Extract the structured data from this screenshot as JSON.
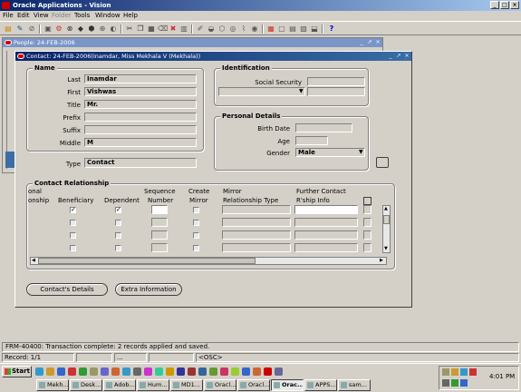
{
  "app": {
    "title": "Oracle Applications - Vision"
  },
  "menu": [
    {
      "label": "File",
      "enabled": true
    },
    {
      "label": "Edit",
      "enabled": true
    },
    {
      "label": "View",
      "enabled": true
    },
    {
      "label": "Folder",
      "enabled": false
    },
    {
      "label": "Tools",
      "enabled": true
    },
    {
      "label": "Window",
      "enabled": true
    },
    {
      "label": "Help",
      "enabled": true
    }
  ],
  "people_window": {
    "title": "People: 24-FEB-2006"
  },
  "contact_window": {
    "title": "Contact: 24-FEB-2006(Inamdar, Miss Mekhala V (Mekhala))",
    "name": {
      "group_label": "Name",
      "last_label": "Last",
      "last_value": "Inamdar",
      "first_label": "First",
      "first_value": "Vishwas",
      "title_label": "Title",
      "title_value": "Mr.",
      "prefix_label": "Prefix",
      "prefix_value": "",
      "suffix_label": "Suffix",
      "suffix_value": "",
      "middle_label": "Middle",
      "middle_value": "M"
    },
    "identification": {
      "group_label": "Identification",
      "ssn_label": "Social Security",
      "ssn_value": ""
    },
    "personal": {
      "group_label": "Personal Details",
      "birth_label": "Birth Date",
      "birth_value": "",
      "age_label": "Age",
      "age_value": "",
      "gender_label": "Gender",
      "gender_value": "Male"
    },
    "type": {
      "label": "Type",
      "value": "Contact"
    },
    "relationship": {
      "group_label": "Contact Relationship",
      "col_primary_top": "onal",
      "col_primary_bottom": "onship",
      "col_beneficiary": "Beneficiary",
      "col_dependent": "Dependent",
      "col_sequence_top": "Sequence",
      "col_sequence_bottom": "Number",
      "col_create_top": "Create",
      "col_create_bottom": "Mirror",
      "col_mirror_top": "Mirror",
      "col_mirror_bottom": "Relationship Type",
      "col_further_top": "Further Contact",
      "col_further_bottom": "R'ship Info",
      "rows": [
        {
          "beneficiary": true,
          "dependent": true
        },
        {
          "beneficiary": false,
          "dependent": false
        },
        {
          "beneficiary": false,
          "dependent": false
        },
        {
          "beneficiary": false,
          "dependent": false
        }
      ]
    },
    "buttons": {
      "details": "Contact's Details",
      "extra": "Extra Information"
    }
  },
  "status": {
    "message": "FRM-40400: Transaction complete: 2 records applied and saved.",
    "record": "Record: 1/1",
    "dots": "...",
    "osc": "<OSC>"
  },
  "taskbar": {
    "start": "Start",
    "clock": "4:01 PM",
    "tasks": [
      "Mekh...",
      "Desk...",
      "Adob...",
      "Hum...",
      "MD1...",
      "Oracl...",
      "Oracl...",
      "Orac...",
      "APPS...",
      "sam..."
    ]
  }
}
